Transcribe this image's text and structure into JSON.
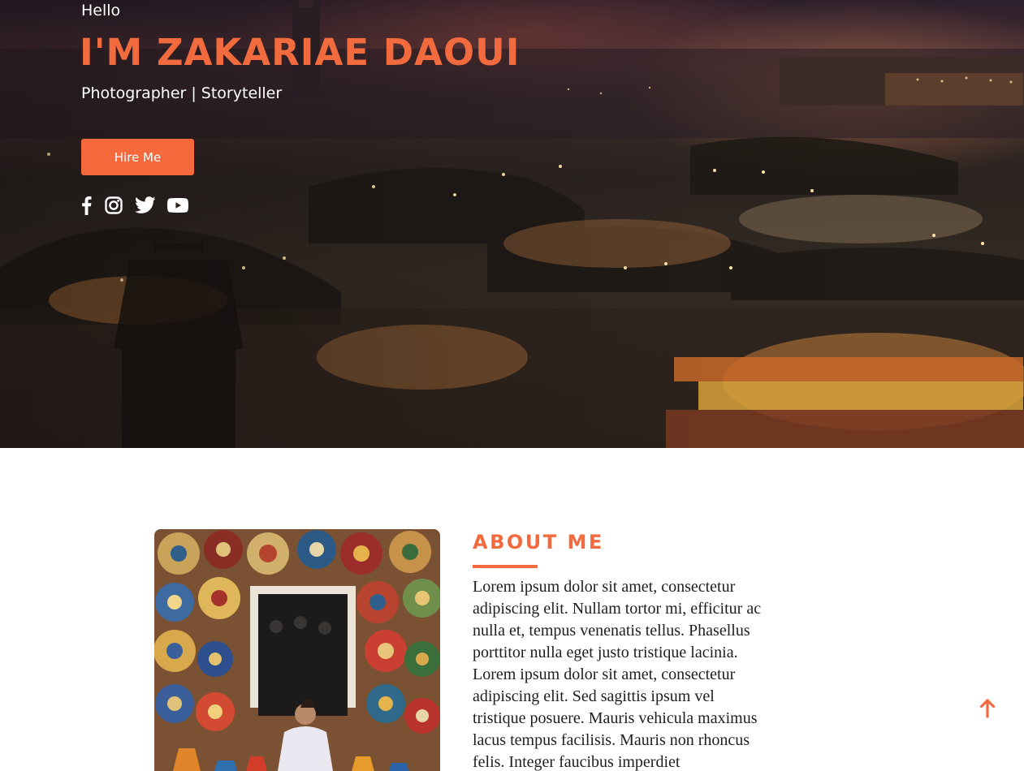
{
  "hero": {
    "greeting": "Hello",
    "name": "I'M ZAKARIAE DAOUI",
    "tagline": "Photographer | Storyteller",
    "hire_button_label": "Hire Me",
    "socials": [
      {
        "icon": "facebook-icon"
      },
      {
        "icon": "instagram-icon"
      },
      {
        "icon": "twitter-icon"
      },
      {
        "icon": "youtube-icon"
      }
    ],
    "background_image": "night market square with lit stalls and crowd"
  },
  "about": {
    "heading": "ABOUT ME",
    "body": "Lorem ipsum dolor sit amet, consectetur adipiscing elit. Nullam tortor mi, efficitur ac nulla et, tempus venenatis tellus. Phasellus porttitor nulla eget justo tristique lacinia. Lorem ipsum dolor sit amet, consectetur adipiscing elit. Sed sagittis ipsum vel tristique posuere. Mauris vehicula maximus lacus tempus facilisis. Mauris non rhoncus felis. Integer faucibus imperdiet condimentum.",
    "photo": "man seated in front of wall of painted ceramic plates"
  },
  "scroll_top": {
    "icon": "arrow-up-icon"
  },
  "colors": {
    "accent": "#f26b3f",
    "button": "#f6693d",
    "text_light": "#ffffff",
    "text_dark": "#1e1e1e"
  }
}
